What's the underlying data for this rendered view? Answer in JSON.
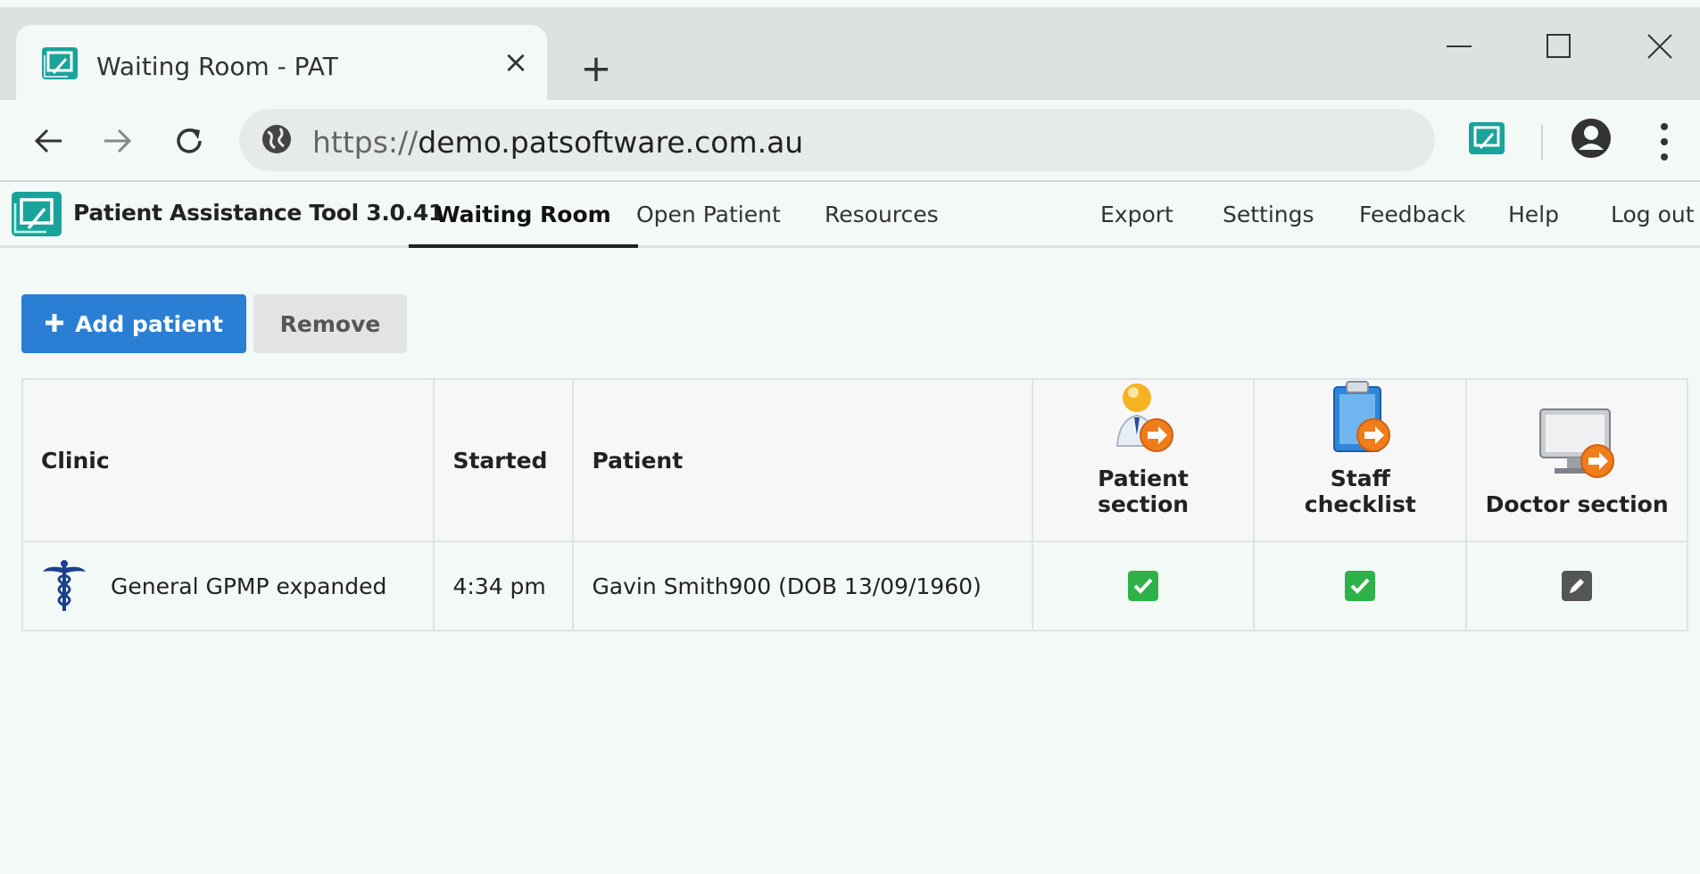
{
  "browser": {
    "tab_title": "Waiting Room - PAT",
    "url_scheme": "https://",
    "url_host": "demo.patsoftware.com.au",
    "new_tab_label": "+",
    "tab_close_label": "×"
  },
  "app": {
    "title": "Patient Assistance Tool 3.0.41",
    "nav_left": [
      "Waiting Room",
      "Open Patient",
      "Resources"
    ],
    "nav_right": [
      "Export",
      "Settings",
      "Feedback",
      "Help",
      "Log out"
    ],
    "active_nav": "Waiting Room"
  },
  "actions": {
    "add_label": "Add patient",
    "remove_label": "Remove"
  },
  "table": {
    "headers": {
      "clinic": "Clinic",
      "started": "Started",
      "patient": "Patient",
      "patient_section": "Patient section",
      "staff_checklist": "Staff checklist",
      "doctor_section": "Doctor section"
    },
    "rows": [
      {
        "clinic": "General GPMP expanded",
        "started": "4:34 pm",
        "patient": "Gavin Smith900 (DOB 13/09/1960)",
        "patient_section": "complete-checkbox-icon",
        "staff_checklist": "complete-checkbox-icon",
        "doctor_section": "edit-icon"
      }
    ]
  },
  "colors": {
    "primary": "#2a7fd4",
    "check_green": "#2fb14a",
    "edit_gray": "#555555",
    "logo_teal": "#1aa39b"
  }
}
